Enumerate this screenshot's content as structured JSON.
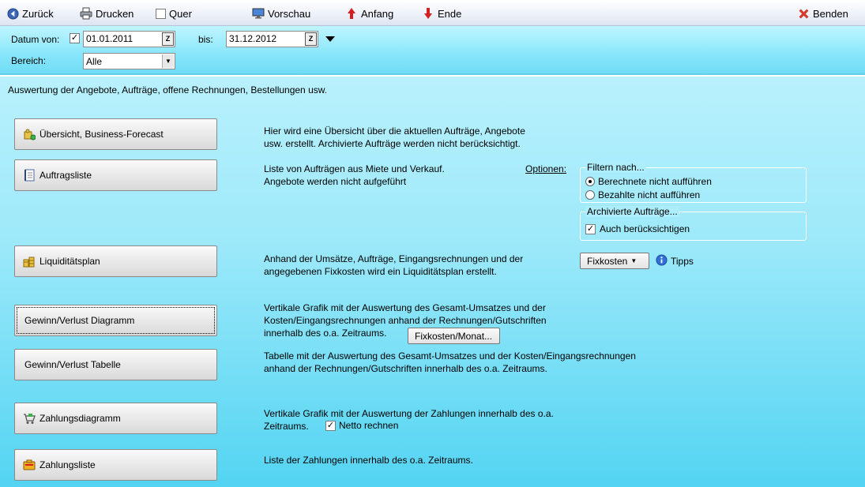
{
  "toolbar": {
    "back_label": "Zurück",
    "print_label": "Drucken",
    "landscape_label": "Quer",
    "preview_label": "Vorschau",
    "start_label": "Anfang",
    "end_label": "Ende",
    "close_label": "Benden"
  },
  "filter": {
    "date_from_label": "Datum von:",
    "date_from_value": "01.01.2011",
    "date_to_label": "bis:",
    "date_to_value": "31.12.2012",
    "area_label": "Bereich:",
    "area_value": "Alle"
  },
  "intro": "Auswertung der Angebote, Aufträge, offene Rechnungen, Bestellungen usw.",
  "reports": [
    {
      "label": "Übersicht, Business-Forecast",
      "desc1": "Hier wird eine Übersicht über die aktuellen Aufträge, Angebote",
      "desc2": "usw. erstellt. Archivierte Aufträge werden nicht berücksichtigt."
    },
    {
      "label": "Auftragsliste",
      "desc1": "Liste von Aufträgen aus Miete und Verkauf.",
      "desc2": "Angebote werden nicht aufgeführt"
    },
    {
      "label": "Liquiditätsplan",
      "desc1": "Anhand der Umsätze, Aufträge, Eingangsrechnungen und der",
      "desc2": "angegebenen Fixkosten wird ein Liquiditätsplan erstellt."
    },
    {
      "label": "Gewinn/Verlust Diagramm",
      "desc1": "Vertikale Grafik mit der Auswertung des Gesamt-Umsatzes und der",
      "desc2": "Kosten/Eingangsrechnungen anhand der Rechnungen/Gutschriften",
      "desc3": "innerhalb des o.a. Zeitraums."
    },
    {
      "label": "Gewinn/Verlust Tabelle",
      "desc1": "Tabelle mit der Auswertung des Gesamt-Umsatzes und der Kosten/Eingangsrechnungen",
      "desc2": "anhand der Rechnungen/Gutschriften innerhalb des o.a. Zeitraums."
    },
    {
      "label": "Zahlungsdiagramm",
      "desc1": "Vertikale Grafik mit der Auswertung der Zahlungen innerhalb des o.a.",
      "desc2": "Zeitraums."
    },
    {
      "label": "Zahlungsliste",
      "desc1": "Liste der Zahlungen innerhalb des o.a. Zeitraums."
    }
  ],
  "options": {
    "options_label": "Optionen:",
    "filter_title": "Filtern nach...",
    "radio1": "Berechnete nicht aufführen",
    "radio2": "Bezahlte nicht aufführen",
    "archived_title": "Archivierte Aufträge...",
    "archived_check": "Auch berücksichtigen",
    "fixkosten_btn": "Fixkosten",
    "tipps_label": "Tipps",
    "fixkosten_month_btn": "Fixkosten/Monat...",
    "netto_label": "Netto rechnen"
  },
  "colors": {
    "accent_red": "#d42020",
    "info_blue": "#2f6fd6"
  }
}
